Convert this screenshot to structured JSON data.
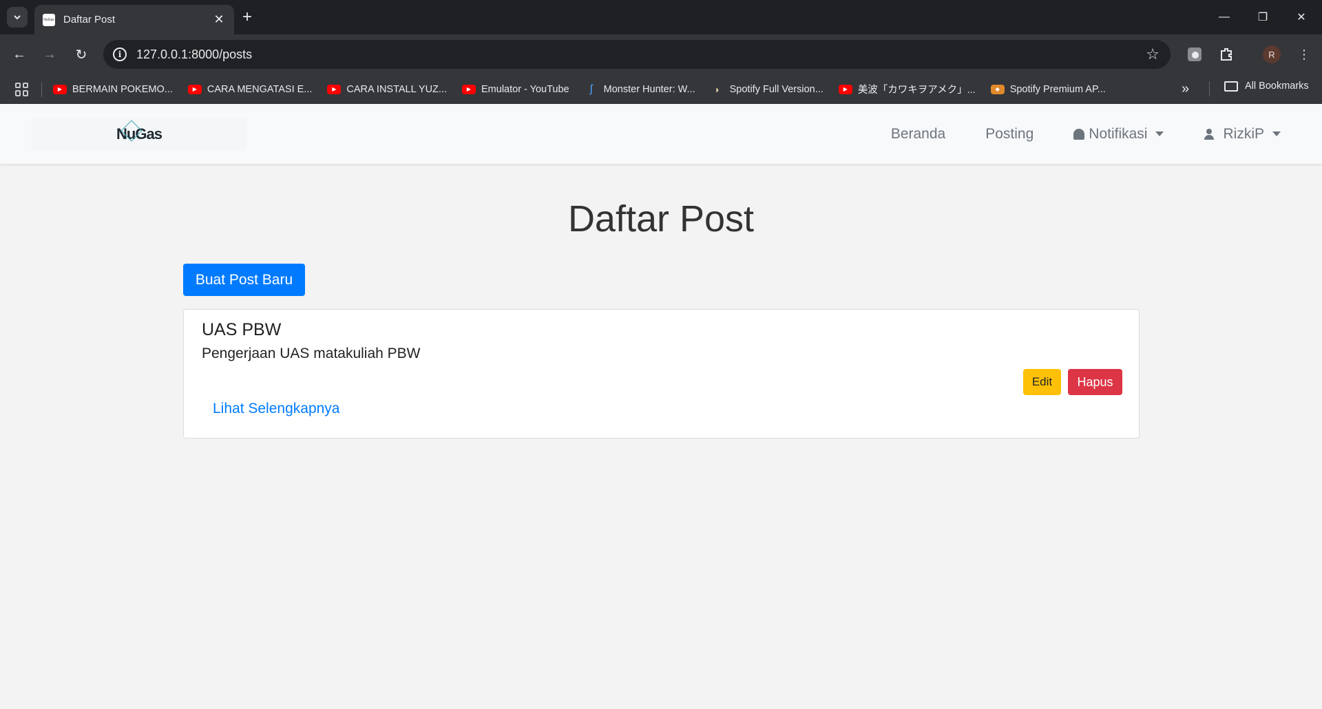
{
  "browser": {
    "tab_title": "Daftar Post",
    "favicon_text": "NuGas",
    "url": "127.0.0.1:8000/posts",
    "avatar_letter": "R",
    "bookmarks": [
      {
        "label": "BERMAIN POKEMO...",
        "icon": "youtube-icon"
      },
      {
        "label": "CARA MENGATASI E...",
        "icon": "youtube-icon"
      },
      {
        "label": "CARA INSTALL YUZ...",
        "icon": "youtube-icon"
      },
      {
        "label": "Emulator - YouTube",
        "icon": "youtube-icon"
      },
      {
        "label": "Monster Hunter: W...",
        "icon": "monster-hunter-icon"
      },
      {
        "label": "Spotify Full Version...",
        "icon": "spotify-icon"
      },
      {
        "label": "美波「カワキヲアメク」...",
        "icon": "youtube-icon"
      },
      {
        "label": "Spotify Premium AP...",
        "icon": "spotify-premium-icon"
      }
    ],
    "all_bookmarks": "All Bookmarks"
  },
  "navbar": {
    "brand": "NuGas",
    "links": {
      "beranda": "Beranda",
      "posting": "Posting",
      "notifikasi": "Notifikasi",
      "user": "RizkiP"
    }
  },
  "main": {
    "title": "Daftar Post",
    "create_button": "Buat Post Baru",
    "posts": [
      {
        "title": "UAS PBW",
        "body": "Pengerjaan UAS matakuliah PBW",
        "link": "Lihat Selengkapnya",
        "edit": "Edit",
        "delete": "Hapus"
      }
    ]
  },
  "colors": {
    "primary": "#007bff",
    "warning": "#ffc107",
    "danger": "#dc3545"
  }
}
